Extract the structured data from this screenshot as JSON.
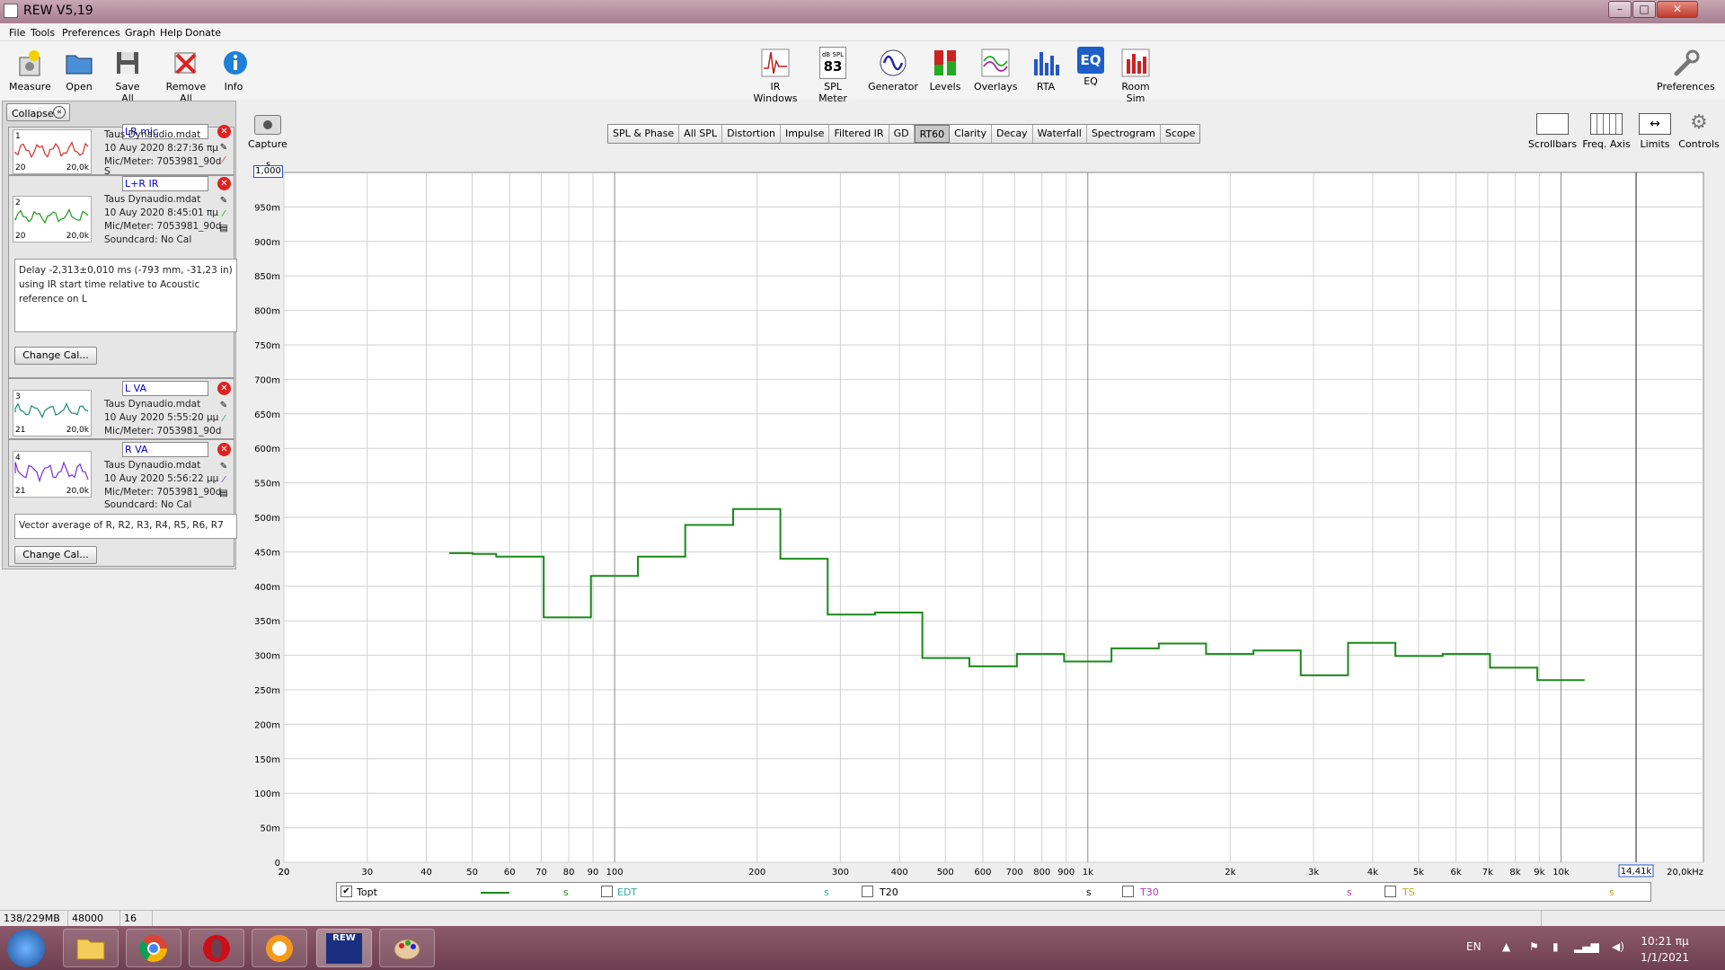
{
  "window": {
    "title": "REW V5,19"
  },
  "menu": [
    "File",
    "Tools",
    "Preferences",
    "Graph",
    "Help",
    "Donate"
  ],
  "toolbar": {
    "left": [
      "Measure",
      "Open",
      "Save All",
      "Remove All",
      "Info"
    ],
    "center": [
      "IR Windows",
      "SPL Meter",
      "Generator",
      "Levels",
      "Overlays",
      "RTA",
      "EQ",
      "Room Sim"
    ],
    "spl_label": "dB SPL",
    "spl_value": "83",
    "eq_icon_text": "EQ",
    "preferences": "Preferences"
  },
  "sidepanel": {
    "collapse": "Collapse",
    "thumb_lo": "20",
    "thumb_hi": "20,0k",
    "thumb_lo_21": "21",
    "change_cal": "Change Cal...",
    "soundcard_short": "S",
    "entries": [
      {
        "num": "1",
        "name": "LR mic",
        "file": "Taus Dynaudio.mdat",
        "date": "10 Auy 2020 8:27:36 πμ",
        "mic": "Mic/Meter: 7053981_90d",
        "color": "#d32f2f"
      },
      {
        "num": "2",
        "name": "L+R IR",
        "file": "Taus Dynaudio.mdat",
        "date": "10 Auy 2020 8:45:01 πμ",
        "mic": "Mic/Meter: 7053981_90d",
        "soundcard": "Soundcard: No Cal",
        "color": "#1a9a1a"
      },
      {
        "num": "3",
        "name": "L VA",
        "file": "Taus Dynaudio.mdat",
        "date": "10 Auy 2020 5:55:20 μμ",
        "mic": "Mic/Meter: 7053981_90d",
        "color": "#1b8a7a"
      },
      {
        "num": "4",
        "name": "R VA",
        "file": "Taus Dynaudio.mdat",
        "date": "10 Auy 2020 5:56:22 μμ",
        "mic": "Mic/Meter: 7053981_90d",
        "soundcard": "Soundcard: No Cal",
        "color": "#7a2fd3"
      }
    ],
    "note_delay": "Delay -2,313±0,010 ms (-793 mm, -31,23 in) using IR start time relative to Acoustic reference on  L",
    "note_vector": "Vector average of R, R2, R3, R4, R5, R6, R7"
  },
  "tabs": [
    "SPL & Phase",
    "All SPL",
    "Distortion",
    "Impulse",
    "Filtered IR",
    "GD",
    "RT60",
    "Clarity",
    "Decay",
    "Waterfall",
    "Spectrogram",
    "Scope"
  ],
  "active_tab": "RT60",
  "capture": "Capture",
  "right_tools": [
    "Scrollbars",
    "Freq. Axis",
    "Limits",
    "Controls"
  ],
  "chart_data": {
    "type": "line",
    "title": "",
    "xlabel": "",
    "ylabel": "s",
    "x_scale": "log",
    "xlim": [
      20,
      20000
    ],
    "ylim": [
      0,
      1.0
    ],
    "y_ticks": [
      "0",
      "50m",
      "100m",
      "150m",
      "200m",
      "250m",
      "300m",
      "350m",
      "400m",
      "450m",
      "500m",
      "550m",
      "600m",
      "650m",
      "700m",
      "750m",
      "800m",
      "850m",
      "900m",
      "950m"
    ],
    "y_top_box": "1,000",
    "y_unit": "s",
    "x_ticks": [
      {
        "v": 20,
        "l": "20"
      },
      {
        "v": 30,
        "l": "30"
      },
      {
        "v": 40,
        "l": "40"
      },
      {
        "v": 50,
        "l": "50"
      },
      {
        "v": 60,
        "l": "60"
      },
      {
        "v": 70,
        "l": "70"
      },
      {
        "v": 80,
        "l": "80"
      },
      {
        "v": 90,
        "l": "90"
      },
      {
        "v": 100,
        "l": "100"
      },
      {
        "v": 200,
        "l": "200"
      },
      {
        "v": 300,
        "l": "300"
      },
      {
        "v": 400,
        "l": "400"
      },
      {
        "v": 500,
        "l": "500"
      },
      {
        "v": 600,
        "l": "600"
      },
      {
        "v": 700,
        "l": "700"
      },
      {
        "v": 800,
        "l": "800"
      },
      {
        "v": 900,
        "l": "900"
      },
      {
        "v": 1000,
        "l": "1k"
      },
      {
        "v": 2000,
        "l": "2k"
      },
      {
        "v": 3000,
        "l": "3k"
      },
      {
        "v": 4000,
        "l": "4k"
      },
      {
        "v": 5000,
        "l": "5k"
      },
      {
        "v": 6000,
        "l": "6k"
      },
      {
        "v": 7000,
        "l": "7k"
      },
      {
        "v": 8000,
        "l": "8k"
      },
      {
        "v": 9000,
        "l": "9k"
      },
      {
        "v": 10000,
        "l": "10k"
      }
    ],
    "x_end_label": "20,0kHz",
    "cursor_freq": 14410,
    "cursor_label": "14,41k",
    "series_color": "#1a8a1a",
    "bands": [
      {
        "f": 44.7,
        "v": 0.448
      },
      {
        "f": 50.1,
        "v": 0.447
      },
      {
        "f": 56.2,
        "v": 0.443
      },
      {
        "f": 63.1,
        "v": 0.443
      },
      {
        "f": 70.8,
        "v": 0.355
      },
      {
        "f": 79.4,
        "v": 0.355
      },
      {
        "f": 89.1,
        "v": 0.415
      },
      {
        "f": 100,
        "v": 0.415
      },
      {
        "f": 112,
        "v": 0.443
      },
      {
        "f": 126,
        "v": 0.443
      },
      {
        "f": 141,
        "v": 0.489
      },
      {
        "f": 158,
        "v": 0.489
      },
      {
        "f": 178,
        "v": 0.512
      },
      {
        "f": 200,
        "v": 0.512
      },
      {
        "f": 224,
        "v": 0.44
      },
      {
        "f": 251,
        "v": 0.44
      },
      {
        "f": 282,
        "v": 0.359
      },
      {
        "f": 316,
        "v": 0.359
      },
      {
        "f": 355,
        "v": 0.362
      },
      {
        "f": 398,
        "v": 0.362
      },
      {
        "f": 447,
        "v": 0.296
      },
      {
        "f": 501,
        "v": 0.296
      },
      {
        "f": 562,
        "v": 0.284
      },
      {
        "f": 631,
        "v": 0.284
      },
      {
        "f": 708,
        "v": 0.302
      },
      {
        "f": 794,
        "v": 0.302
      },
      {
        "f": 891,
        "v": 0.291
      },
      {
        "f": 1000,
        "v": 0.291
      },
      {
        "f": 1122,
        "v": 0.31
      },
      {
        "f": 1259,
        "v": 0.31
      },
      {
        "f": 1413,
        "v": 0.317
      },
      {
        "f": 1585,
        "v": 0.317
      },
      {
        "f": 1778,
        "v": 0.302
      },
      {
        "f": 1995,
        "v": 0.302
      },
      {
        "f": 2239,
        "v": 0.307
      },
      {
        "f": 2512,
        "v": 0.307
      },
      {
        "f": 2818,
        "v": 0.271
      },
      {
        "f": 3162,
        "v": 0.271
      },
      {
        "f": 3548,
        "v": 0.318
      },
      {
        "f": 3981,
        "v": 0.318
      },
      {
        "f": 4467,
        "v": 0.299
      },
      {
        "f": 5012,
        "v": 0.299
      },
      {
        "f": 5623,
        "v": 0.302
      },
      {
        "f": 6310,
        "v": 0.302
      },
      {
        "f": 7079,
        "v": 0.282
      },
      {
        "f": 7943,
        "v": 0.282
      },
      {
        "f": 8913,
        "v": 0.264
      },
      {
        "f": 10000,
        "v": 0.264
      },
      {
        "f": 11220,
        "v": 0.264
      }
    ]
  },
  "legend": {
    "items": [
      {
        "label": "Topt",
        "checked": true,
        "unit": "s",
        "color": "#000000",
        "unit_color": "#1a8a1a"
      },
      {
        "label": "EDT",
        "checked": false,
        "unit": "s",
        "color": "#3aa6a6",
        "unit_color": "#3aa6a6"
      },
      {
        "label": "T20",
        "checked": false,
        "unit": "s",
        "color": "#000000",
        "unit_color": "#000000"
      },
      {
        "label": "T30",
        "checked": false,
        "unit": "s",
        "color": "#b23ab2",
        "unit_color": "#b23ab2"
      },
      {
        "label": "TS",
        "checked": false,
        "unit": "s",
        "color": "#c9a227",
        "unit_color": "#c9a227"
      }
    ]
  },
  "status": {
    "memory": "138/229MB",
    "rate": "48000 Hz",
    "bits": "16 Bit"
  },
  "taskbar": {
    "lang": "EN",
    "time": "10:21 πμ",
    "date": "1/1/2021",
    "rew_label": "REW"
  }
}
